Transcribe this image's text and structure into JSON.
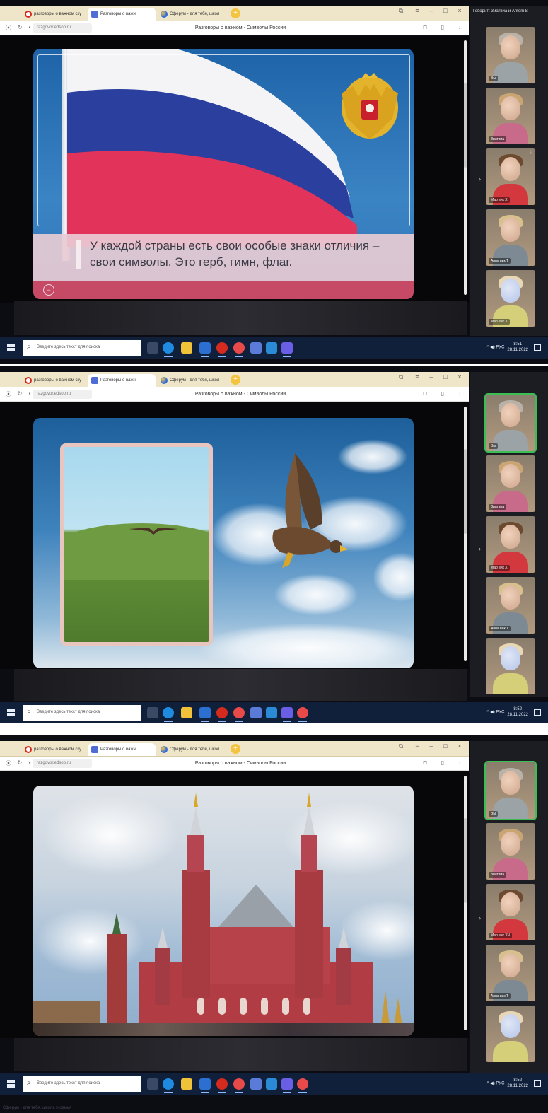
{
  "browser": {
    "tabs": [
      {
        "label": "разговоры о важном ску"
      },
      {
        "label": "Разговоры о важн"
      },
      {
        "label": "Сферум - для тебя, школ"
      }
    ],
    "url": "razgovor.edsoo.ru",
    "page_title": "Разговоры о важном - Символы России"
  },
  "slides": {
    "slide1_caption": "У каждой страны есть свои особые знаки отличия – свои символы. Это герб, гимн, флаг."
  },
  "participants": {
    "header": "Говорит: Зиатвиа и Antom B",
    "shot1": [
      "Вы",
      "Зиатвиа",
      "Мар вик Х",
      "Анна вик Т",
      "Мар вик Х"
    ],
    "shot2": [
      "Вы",
      "Зиатвиа",
      "Мар вик Х",
      "Анна вик Т",
      ""
    ],
    "shot3": [
      "Вы",
      "Зиатвиа",
      "Мар вик ХЧ",
      "Анна вик Т",
      ""
    ]
  },
  "taskbar": {
    "search_placeholder": "Введите здесь текст для поиска",
    "tray_lang": "РУС",
    "shot1_time": "8:51",
    "shot2_time": "8:52",
    "shot3_time": "8:52",
    "date": "28.11.2022"
  },
  "bottom_caption": "Сферум - для тебя, школа и семья"
}
